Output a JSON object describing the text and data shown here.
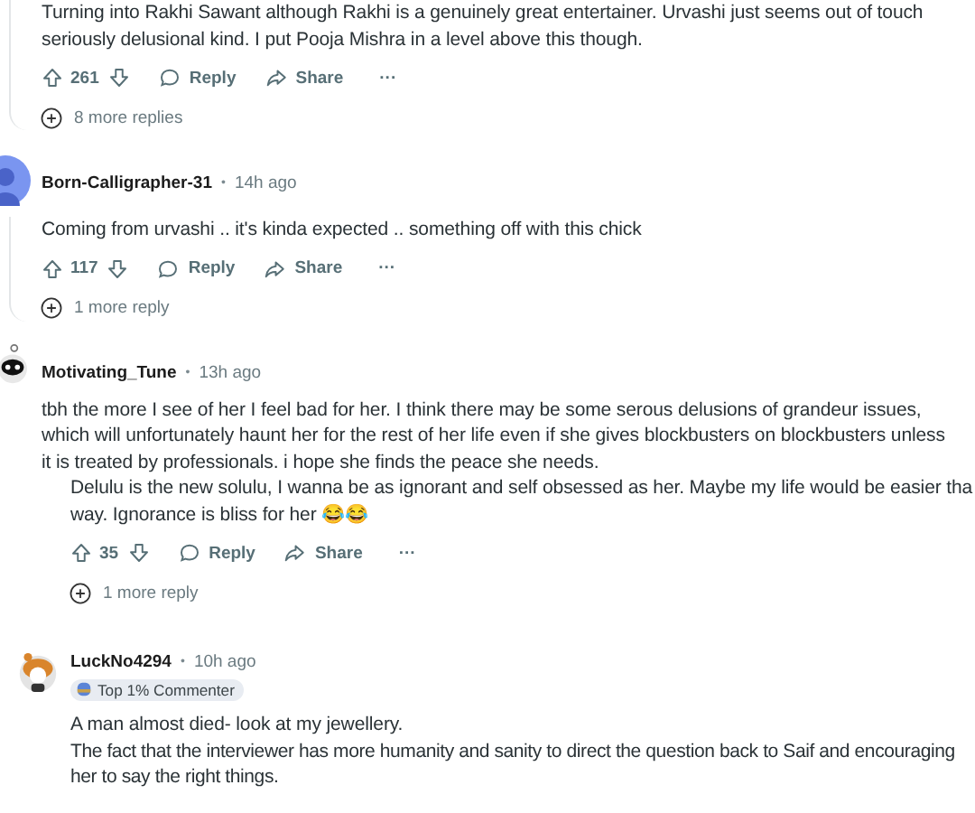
{
  "comments": [
    {
      "kind": "tail",
      "body": [
        "Turning into Rakhi Sawant although Rakhi is a genuinely great entertainer. Urvashi just seems out of touch",
        "seriously delusional kind. I put Pooja Mishra in a level above this though."
      ],
      "votes": "261",
      "reply": "Reply",
      "share": "Share",
      "more_menu": "···",
      "more": "8 more replies"
    },
    {
      "kind": "comment",
      "author": "Born-Calligrapher-31",
      "separator": "•",
      "time": "14h ago",
      "body": [
        "Coming from urvashi .. it's kinda expected .. something off with this chick"
      ],
      "votes": "117",
      "reply": "Reply",
      "share": "Share",
      "more_menu": "···",
      "more": "1 more reply"
    },
    {
      "kind": "comment",
      "author": "Motivating_Tune",
      "separator": "•",
      "time": "13h ago",
      "body": [
        "tbh the more I see of her I feel bad for her. I think there may be some serous delusions of grandeur issues,",
        "which will unfortunately haunt her for the rest of her life even if she gives blockbusters on blockbusters unless",
        "it is treated by professionals. i hope she finds the peace she needs."
      ]
    },
    {
      "kind": "pasted",
      "body": [
        "Delulu is the new solulu, I wanna be as ignorant and self obsessed as her. Maybe my life would be easier tha",
        "way. Ignorance is bliss for her 😂😂"
      ],
      "votes": "35",
      "reply": "Reply",
      "share": "Share",
      "more_menu": "···",
      "more": "1 more reply"
    },
    {
      "kind": "comment",
      "author": "LuckNo4294",
      "separator": "•",
      "time": "10h ago",
      "badge": "Top 1% Commenter",
      "body": [
        "A man almost died- look at my jewellery."
      ]
    },
    {
      "kind": "pasted",
      "body": [
        "The fact that the interviewer has more humanity and sanity to direct the question back to Saif and encouraging",
        "her to say the right things."
      ]
    }
  ]
}
